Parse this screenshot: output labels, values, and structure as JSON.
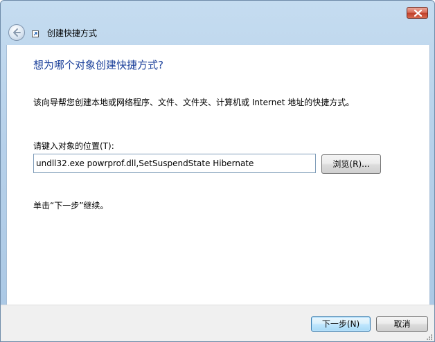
{
  "window": {
    "title": "创建快捷方式"
  },
  "wizard": {
    "heading": "想为哪个对象创建快捷方式?",
    "description": "该向导帮您创建本地或网络程序、文件、文件夹、计算机或 Internet 地址的快捷方式。",
    "location_label": "请键入对象的位置(T):",
    "location_value": "undll32.exe powrprof.dll,SetSuspendState Hibernate",
    "browse_label": "浏览(R)...",
    "instruction": "单击“下一步”继续。"
  },
  "footer": {
    "next_label": "下一步(N)",
    "cancel_label": "取消"
  },
  "icons": {
    "close": "close-icon",
    "back": "back-arrow-icon",
    "shortcut": "shortcut-icon",
    "grip": "resize-grip-icon"
  },
  "colors": {
    "heading": "#1a3f9a",
    "close_button": "#c0402b",
    "title_bar": "#b7d1ea"
  }
}
